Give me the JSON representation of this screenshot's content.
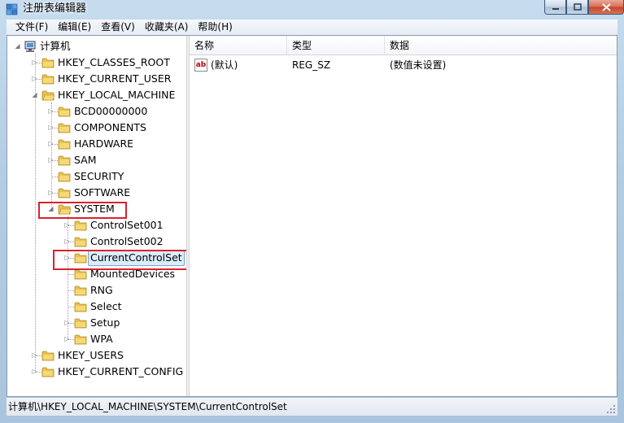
{
  "window": {
    "title": "注册表编辑器"
  },
  "menu": [
    {
      "label": "文件(F)"
    },
    {
      "label": "编辑(E)"
    },
    {
      "label": "查看(V)"
    },
    {
      "label": "收藏夹(A)"
    },
    {
      "label": "帮助(H)"
    }
  ],
  "tree": {
    "root": "计算机",
    "hkcr": "HKEY_CLASSES_ROOT",
    "hkcu": "HKEY_CURRENT_USER",
    "hklm": "HKEY_LOCAL_MACHINE",
    "bcd": "BCD00000000",
    "components": "COMPONENTS",
    "hardware": "HARDWARE",
    "sam": "SAM",
    "security": "SECURITY",
    "software": "SOFTWARE",
    "system": "SYSTEM",
    "cs001": "ControlSet001",
    "cs002": "ControlSet002",
    "ccs": "CurrentControlSet",
    "mounted": "MountedDevices",
    "rng": "RNG",
    "select": "Select",
    "setup": "Setup",
    "wpa": "WPA",
    "hku": "HKEY_USERS",
    "hkcc": "HKEY_CURRENT_CONFIG"
  },
  "list": {
    "columns": [
      "名称",
      "类型",
      "数据"
    ],
    "rows": [
      {
        "icon": "string-value-icon",
        "name": "(默认)",
        "type": "REG_SZ",
        "data": "(数值未设置)"
      }
    ],
    "icon_text": "ab"
  },
  "status": {
    "path": "计算机\\HKEY_LOCAL_MACHINE\\SYSTEM\\CurrentControlSet"
  },
  "colors": {
    "highlight_box": "#d9232e",
    "selection": "#dcecfc",
    "folder": "#e8c252"
  }
}
